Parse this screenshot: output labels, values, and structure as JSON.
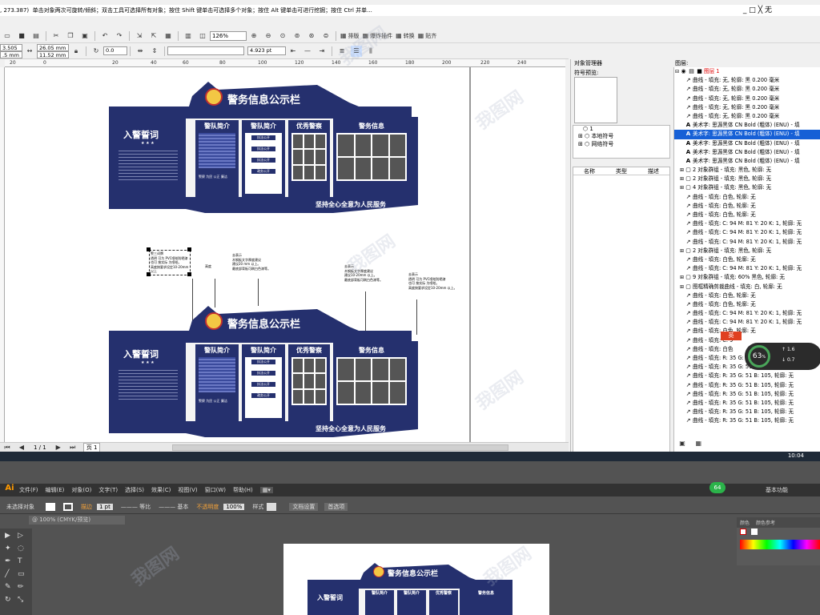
{
  "corel": {
    "status_coords": ", 273.387)",
    "status_message": "单击对象两次可旋转/倾斜；双击工具可选择所有对象；按住 Shift 键单击可选择多个对象；按住 Alt 键单击可进行挖掘；按住 Ctrl 并单...",
    "window_controls": [
      "_",
      "□",
      "╳",
      "无"
    ],
    "zoom": "126%",
    "toolbar_labels": {
      "layout": "排版",
      "effects": "爆炸插件",
      "convert": "转换",
      "paste": "贴齐"
    },
    "prop": {
      "x": "3.505 mm",
      "y": ".5 mm",
      "w": "26.05 mm",
      "h": "11.52 mm",
      "angle": "0.0",
      "outline": "4.923 pt"
    },
    "ruler_ticks": [
      "20",
      "0",
      "20",
      "40",
      "60",
      "80",
      "100",
      "120",
      "140",
      "160",
      "180",
      "200",
      "220",
      "240"
    ],
    "page_nav": {
      "pos": "1 / 1",
      "page_label": "页 1"
    },
    "object_manager": {
      "title": "对象管理器",
      "symbol_preview_label": "符号预览:",
      "layer_label": "图层:",
      "symbol_root": "1",
      "symbol_local": "本地符号",
      "symbol_network": "网络符号",
      "columns": [
        "名称",
        "类型",
        "描述"
      ],
      "layer_name": "图层 1",
      "rows": [
        {
          "icon": "curve",
          "text": "曲线 - 填充: 无, 轮廓: 黑  0.200 毫米",
          "sel": false,
          "exp": ""
        },
        {
          "icon": "curve",
          "text": "曲线 - 填充: 无, 轮廓: 黑  0.200 毫米",
          "sel": false,
          "exp": ""
        },
        {
          "icon": "curve",
          "text": "曲线 - 填充: 无, 轮廓: 黑  0.200 毫米",
          "sel": false,
          "exp": ""
        },
        {
          "icon": "curve",
          "text": "曲线 - 填充: 无, 轮廓: 黑  0.200 毫米",
          "sel": false,
          "exp": ""
        },
        {
          "icon": "curve",
          "text": "曲线 - 填充: 无, 轮廓: 黑  0.200 毫米",
          "sel": false,
          "exp": ""
        },
        {
          "icon": "text",
          "text": "美术字: 思源黑体 CN Bold (粗体) (ENU) - 填",
          "sel": false,
          "exp": ""
        },
        {
          "icon": "text",
          "text": "美术字: 思源黑体 CN Bold (粗体) (ENU) - 填",
          "sel": true,
          "exp": ""
        },
        {
          "icon": "text",
          "text": "美术字: 思源黑体 CN Bold (粗体) (ENU) - 填",
          "sel": false,
          "exp": ""
        },
        {
          "icon": "text",
          "text": "美术字: 思源黑体 CN Bold (粗体) (ENU) - 填",
          "sel": false,
          "exp": ""
        },
        {
          "icon": "text",
          "text": "美术字: 思源黑体 CN Bold (粗体) (ENU) - 填",
          "sel": false,
          "exp": ""
        },
        {
          "icon": "group",
          "text": "2 对象群组 - 填充: 黑色, 轮廓: 无",
          "sel": false,
          "exp": "+"
        },
        {
          "icon": "group",
          "text": "2 对象群组 - 填充: 黑色, 轮廓: 无",
          "sel": false,
          "exp": "+"
        },
        {
          "icon": "group",
          "text": "4 对象群组 - 填充: 黑色, 轮廓: 无",
          "sel": false,
          "exp": "+"
        },
        {
          "icon": "curve",
          "text": "曲线 - 填充: 白色, 轮廓: 无",
          "sel": false,
          "exp": ""
        },
        {
          "icon": "curve",
          "text": "曲线 - 填充: 白色, 轮廓: 无",
          "sel": false,
          "exp": ""
        },
        {
          "icon": "curve",
          "text": "曲线 - 填充: 白色, 轮廓: 无",
          "sel": false,
          "exp": ""
        },
        {
          "icon": "curve",
          "text": "曲线 - 填充: C: 94 M: 81 Y: 20 K: 1, 轮廓: 无",
          "sel": false,
          "exp": ""
        },
        {
          "icon": "curve",
          "text": "曲线 - 填充: C: 94 M: 81 Y: 20 K: 1, 轮廓: 无",
          "sel": false,
          "exp": ""
        },
        {
          "icon": "curve",
          "text": "曲线 - 填充: C: 94 M: 81 Y: 20 K: 1, 轮廓: 无",
          "sel": false,
          "exp": ""
        },
        {
          "icon": "group",
          "text": "2 对象群组 - 填充: 黑色, 轮廓: 无",
          "sel": false,
          "exp": "+"
        },
        {
          "icon": "curve",
          "text": "曲线 - 填充: 白色, 轮廓: 无",
          "sel": false,
          "exp": ""
        },
        {
          "icon": "curve",
          "text": "曲线 - 填充: C: 94 M: 81 Y: 20 K: 1, 轮廓: 无",
          "sel": false,
          "exp": ""
        },
        {
          "icon": "group",
          "text": "9 对象群组 - 填充: 60% 黑色, 轮廓: 无",
          "sel": false,
          "exp": "+"
        },
        {
          "icon": "group",
          "text": "图框精确剪裁曲线 - 填充: 白, 轮廓: 无",
          "sel": false,
          "exp": "+"
        },
        {
          "icon": "curve",
          "text": "曲线 - 填充: 白色, 轮廓: 无",
          "sel": false,
          "exp": ""
        },
        {
          "icon": "curve",
          "text": "曲线 - 填充: 白色, 轮廓: 无",
          "sel": false,
          "exp": ""
        },
        {
          "icon": "curve",
          "text": "曲线 - 填充: C: 94 M: 81 Y: 20 K: 1, 轮廓: 无",
          "sel": false,
          "exp": ""
        },
        {
          "icon": "curve",
          "text": "曲线 - 填充: C: 94 M: 81 Y: 20 K: 1, 轮廓: 无",
          "sel": false,
          "exp": ""
        },
        {
          "icon": "curve",
          "text": "曲线 - 填充: 白色, 轮廓: 无",
          "sel": false,
          "exp": ""
        },
        {
          "icon": "curve",
          "text": "曲线 - 填充: C: 9",
          "sel": false,
          "exp": ""
        },
        {
          "icon": "curve",
          "text": "曲线 - 填充: 白色",
          "sel": false,
          "exp": ""
        },
        {
          "icon": "curve",
          "text": "曲线 - 填充: R: 35 G: 51 B: 105, 轮廓: 无",
          "sel": false,
          "exp": ""
        },
        {
          "icon": "curve",
          "text": "曲线 - 填充: R: 35 G: 51 B: 105, 轮廓: 无",
          "sel": false,
          "exp": ""
        },
        {
          "icon": "curve",
          "text": "曲线 - 填充: R: 35 G: 51 B: 105, 轮廓: 无",
          "sel": false,
          "exp": ""
        },
        {
          "icon": "curve",
          "text": "曲线 - 填充: R: 35 G: 51 B: 105, 轮廓: 无",
          "sel": false,
          "exp": ""
        },
        {
          "icon": "curve",
          "text": "曲线 - 填充: R: 35 G: 51 B: 105, 轮廓: 无",
          "sel": false,
          "exp": ""
        },
        {
          "icon": "curve",
          "text": "曲线 - 填充: R: 35 G: 51 B: 105, 轮廓: 无",
          "sel": false,
          "exp": ""
        },
        {
          "icon": "curve",
          "text": "曲线 - 填充: R: 35 G: 51 B: 105, 轮廓: 无",
          "sel": false,
          "exp": ""
        },
        {
          "icon": "curve",
          "text": "曲线 - 填充: R: 35 G: 51 B: 105, 轮廓: 无",
          "sel": false,
          "exp": ""
        }
      ]
    },
    "overlay": {
      "percent": "63",
      "up": "1.6",
      "down": "0.7",
      "ime_label": "英"
    },
    "taskbar_time": "10:04"
  },
  "design": {
    "main_title": "警务信息公示栏",
    "oath_title": "入警誓词",
    "panels": [
      "警队简介",
      "警队简介",
      "优秀警察",
      "警务信息"
    ],
    "slogan": "坚持全心全意为人民服务",
    "sub_tags": [
      "执法公开",
      "执法公开",
      "执法公开",
      "政务公开"
    ],
    "thumb_labels": [
      "警察 为民 公正 廉洁"
    ],
    "annot_left": [
      "警三词牌",
      "透明 可为 PVC喷绘防晒漆",
      "也可 按实际 为喷绘。",
      "高度按要求设定10-20mm 以上"
    ],
    "annot_size_label": "高度",
    "annot_mid": [
      "去表示",
      "木钢板文字厚度建议",
      "建议20 mm 以上。",
      "最底部背板可刷白色漆等。"
    ],
    "annot_right1": [
      "去表示",
      "木钢板文字厚度建议",
      "建议10-20mm 以上。",
      "最底部背板可刷白色漆等。"
    ],
    "annot_right2": [
      "去表示",
      "透明 可为 PVC喷绘防晒漆",
      "也可 按实际 为喷绘。",
      "高度按要求设定10-20mm 以上。"
    ],
    "navy": "#25306e"
  },
  "illustrator": {
    "logo": "Ai",
    "menus": [
      "文件(F)",
      "编辑(E)",
      "对象(O)",
      "文字(T)",
      "选择(S)",
      "效果(C)",
      "视图(V)",
      "窗口(W)",
      "帮助(H)"
    ],
    "workspace": "基本功能",
    "badge": "64",
    "ctl": {
      "no_selection": "未选择对象",
      "stroke_label": "描边",
      "stroke_value": "1 pt",
      "profile": "等比",
      "brush": "基本",
      "opacity_label": "不透明度",
      "opacity": "100%",
      "style_label": "样式",
      "doc_setup": "文档设置",
      "prefs": "首选项"
    },
    "doc_tab": "@ 100% (CMYK/预览)",
    "color_panel_tabs": [
      "颜色",
      "颜色参考"
    ]
  },
  "watermark": "我图网"
}
